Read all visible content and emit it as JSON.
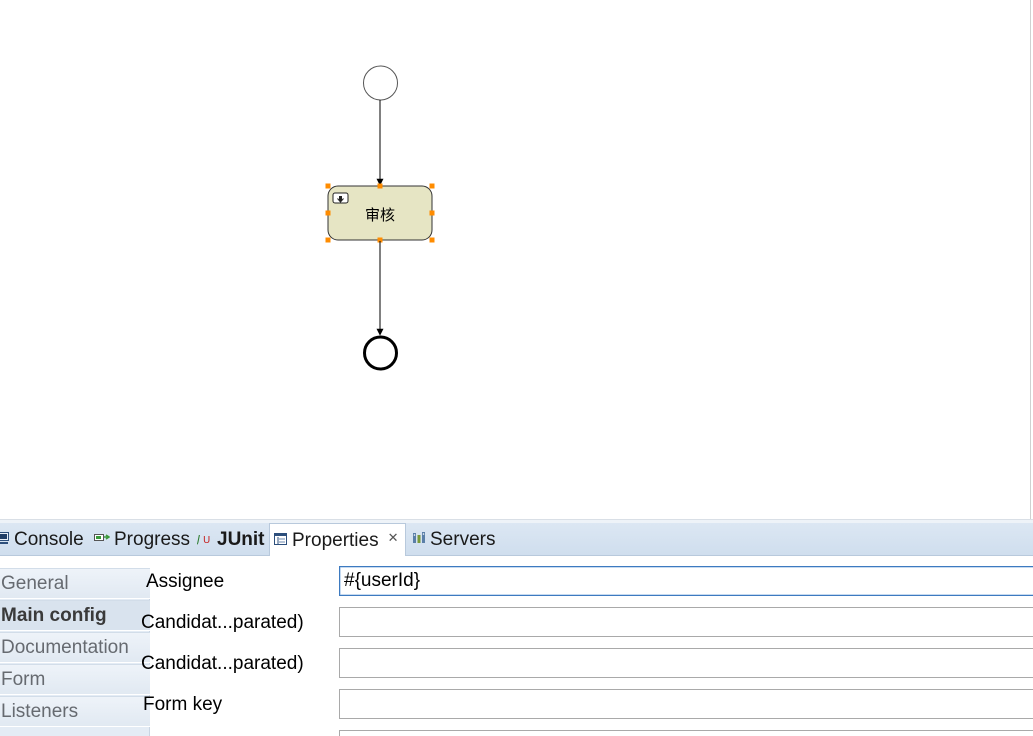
{
  "diagram": {
    "task_label": "审核"
  },
  "bottom_panel": {
    "tabs": [
      {
        "label": "Console",
        "icon": "console-icon"
      },
      {
        "label": "Progress",
        "icon": "progress-icon"
      },
      {
        "label": "JUnit",
        "icon": "junit-icon"
      },
      {
        "label": "Properties",
        "icon": "properties-icon"
      },
      {
        "label": "Servers",
        "icon": "servers-icon"
      }
    ],
    "active_tab": "Properties"
  },
  "properties": {
    "sections": [
      "General",
      "Main config",
      "Documentation",
      "Form",
      "Listeners"
    ],
    "active_section": "Main config",
    "fields": [
      {
        "label": "Assignee",
        "value": "#{userId}"
      },
      {
        "label": "Candidat...parated)",
        "value": ""
      },
      {
        "label": "Candidat...parated)",
        "value": ""
      },
      {
        "label": "Form key",
        "value": ""
      }
    ]
  },
  "colors": {
    "task_fill": "#e6e5c4",
    "selection_handle": "#ff8c00",
    "tabbar": "#d5e2f0"
  }
}
